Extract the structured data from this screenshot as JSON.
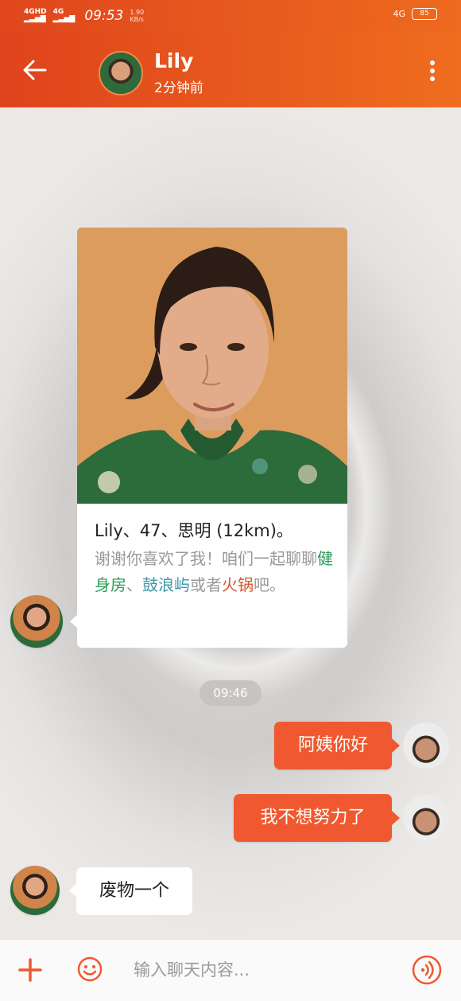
{
  "status_bar": {
    "network1": "4GHD",
    "network2": "4G",
    "time": "09:53",
    "speed_value": "1.90",
    "speed_unit": "KB/s",
    "network_right": "4G",
    "battery": "85"
  },
  "header": {
    "name": "Lily",
    "last_seen": "2分钟前"
  },
  "profile_card": {
    "info": "Lily、47、思明 (12km)。",
    "message_prefix": "谢谢你喜欢了我！咱们一起聊聊",
    "keyword1": "健身房",
    "sep1": "、",
    "keyword2": "鼓浪屿",
    "sep2": "或者",
    "keyword3": "火锅",
    "message_suffix": "吧。",
    "keyword_colors": [
      "#2b9a58",
      "#3a98a8",
      "#d9542b"
    ]
  },
  "timestamp": "09:46",
  "messages": [
    {
      "direction": "out",
      "text": "阿姨你好"
    },
    {
      "direction": "out",
      "text": "我不想努力了"
    },
    {
      "direction": "in",
      "text": "废物一个"
    }
  ],
  "input": {
    "placeholder": "输入聊天内容..."
  },
  "colors": {
    "accent": "#f0582f",
    "header": "#e5501d"
  },
  "icons": [
    "back-arrow-icon",
    "more-vertical-icon",
    "plus-icon",
    "emoji-icon",
    "voice-icon"
  ]
}
